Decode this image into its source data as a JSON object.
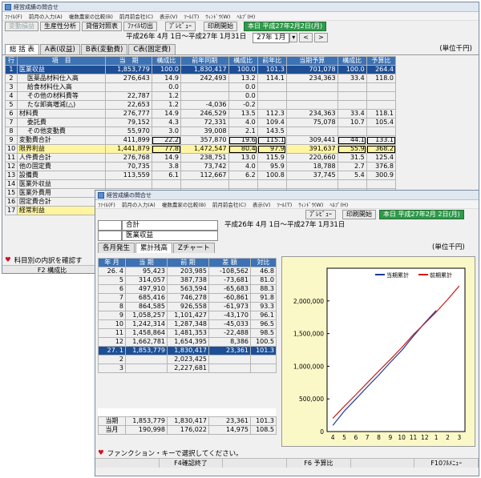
{
  "win1": {
    "title": "経営成績の問合せ",
    "menu": [
      "ﾌｧｲﾙ(F)",
      "前月の入力(A)",
      "複数農家の比較(B)",
      "前月前会社(C)",
      "表示(V)",
      "ﾂｰﾙ(T)",
      "ｳｨﾝﾄﾞｳ(W)",
      "ﾍﾙﾌﾟ(H)"
    ],
    "toolbar": [
      "変動損益",
      "生産性分析",
      "貸借対照表",
      "ﾌｧｲﾙ切出",
      "ﾌﾟﾚﾋﾞｭｰ",
      "印刷開始"
    ],
    "date_badge": "本日 平成27年2月2日(月)",
    "range": "平成26年 4月 1日～平成27年 1月31日",
    "period": "27年 1月",
    "tabs": [
      "総 括 表",
      "A表(収益)",
      "B表(変動費)",
      "C表(固定費)"
    ],
    "unit": "(単位千円)",
    "headers": [
      "行",
      "項　目",
      "当　期",
      "構成比",
      "前年同期",
      "構成比",
      "前年比",
      "当期予算",
      "構成比",
      "予算比"
    ],
    "rows": [
      [
        "1",
        "医業収益",
        "1,853,779",
        "100.0",
        "1,830,417",
        "100.0",
        "101.3",
        "701,078",
        "100.0",
        "264.4"
      ],
      [
        "2",
        "医薬品材料仕入高",
        "276,643",
        "14.9",
        "242,493",
        "13.2",
        "114.1",
        "234,363",
        "33.4",
        "118.0"
      ],
      [
        "3",
        "給食材料仕入高",
        "",
        "0.0",
        "",
        "0.0",
        "",
        "",
        "",
        ""
      ],
      [
        "4",
        "その他の材料費等",
        "22,787",
        "1.2",
        "",
        "0.0",
        "",
        "",
        "",
        ""
      ],
      [
        "5",
        "たな卸高増減(△)",
        "22,653",
        "1.2",
        "-4,036",
        "-0.2",
        "",
        "",
        "",
        ""
      ],
      [
        "6",
        "材料費",
        "276,777",
        "14.9",
        "246,529",
        "13.5",
        "112.3",
        "234,363",
        "33.4",
        "118.1"
      ],
      [
        "7",
        "委託費",
        "79,152",
        "4.3",
        "72,331",
        "4.0",
        "109.4",
        "75,078",
        "10.7",
        "105.4"
      ],
      [
        "8",
        "その他変動費",
        "55,970",
        "3.0",
        "39,008",
        "2.1",
        "143.5",
        "",
        "",
        ""
      ],
      [
        "9",
        "変動費合計",
        "411,899",
        "22.2",
        "357,870",
        "19.6",
        "115.1",
        "309,441",
        "44.1",
        "133.1"
      ],
      [
        "10",
        "限界利益",
        "1,441,879",
        "77.8",
        "1,472,547",
        "80.4",
        "97.9",
        "391,637",
        "55.9",
        "368.2"
      ],
      [
        "11",
        "人件費合計",
        "276,768",
        "14.9",
        "238,751",
        "13.0",
        "115.9",
        "220,660",
        "31.5",
        "125.4"
      ],
      [
        "12",
        "他の固定費",
        "70,735",
        "3.8",
        "73,742",
        "4.0",
        "95.9",
        "18,788",
        "2.7",
        "376.8"
      ],
      [
        "13",
        "設備費",
        "113,559",
        "6.1",
        "112,667",
        "6.2",
        "100.8",
        "37,745",
        "5.4",
        "300.9"
      ],
      [
        "14",
        "医業外収益",
        "",
        "",
        "",
        "",
        "",
        "",
        "",
        ""
      ],
      [
        "15",
        "医業外費用",
        "",
        "",
        "",
        "",
        "",
        "",
        "",
        ""
      ],
      [
        "16",
        "固定費合計",
        "",
        "",
        "",
        "",
        "",
        "",
        "",
        ""
      ],
      [
        "17",
        "経常利益",
        "",
        "",
        "",
        "",
        "",
        "",
        "",
        ""
      ]
    ],
    "status": "科目別の内訳を確認す",
    "fkey": "F2 構成比"
  },
  "win2": {
    "title": "経営成績の問合せ",
    "menu": [
      "ﾌｧｲﾙ(F)",
      "前月の入力(A)",
      "複数農家の比較(B)",
      "前月前会社(C)",
      "表示(V)",
      "ﾂｰﾙ(T)",
      "ｳｨﾝﾄﾞｳ(W)",
      "ﾍﾙﾌﾟ(H)"
    ],
    "preview": "ﾌﾟﾚﾋﾞｭｰ",
    "print": "印刷開始",
    "date_badge": "本日 平成27年2月 2日(月)",
    "item1": "合計",
    "item2": "医業収益",
    "range": "平成26年 4月 1日～平成27年 1月31日",
    "tabs": [
      "各月発生",
      "累計残高",
      "Zチャート"
    ],
    "unit": "(単位千円)",
    "headers": [
      "年 月",
      "当 期",
      "前 期",
      "差 額",
      "対比"
    ],
    "rows": [
      [
        "26. 4",
        "95,423",
        "203,985",
        "-108,562",
        "46.8"
      ],
      [
        "5",
        "314,057",
        "387,738",
        "-73,681",
        "81.0"
      ],
      [
        "6",
        "497,910",
        "563,594",
        "-65,683",
        "88.3"
      ],
      [
        "7",
        "685,416",
        "746,278",
        "-60,861",
        "91.8"
      ],
      [
        "8",
        "864,585",
        "926,558",
        "-61,973",
        "93.3"
      ],
      [
        "9",
        "1,058,257",
        "1,101,427",
        "-43,170",
        "96.1"
      ],
      [
        "10",
        "1,242,314",
        "1,287,348",
        "-45,033",
        "96.5"
      ],
      [
        "11",
        "1,458,864",
        "1,481,353",
        "-22,488",
        "98.5"
      ],
      [
        "12",
        "1,662,781",
        "1,654,395",
        "8,386",
        "100.5"
      ],
      [
        "27. 1",
        "1,853,779",
        "1,830,417",
        "23,361",
        "101.3"
      ],
      [
        "2",
        "",
        "2,023,425",
        "",
        ""
      ],
      [
        "3",
        "",
        "2,227,681",
        "",
        ""
      ]
    ],
    "footer": [
      [
        "当期",
        "1,853,779",
        "1,830,417",
        "23,361",
        "101.3"
      ],
      [
        "当月",
        "190,998",
        "176,022",
        "14,975",
        "108.5"
      ]
    ],
    "status": "ファンクション・キーで選択してください。",
    "fkeys": [
      "",
      "F4確認終了",
      "",
      "F6 予算比",
      "",
      "F10ﾌﾙﾒﾆｭｰ"
    ]
  },
  "chart_data": {
    "type": "line",
    "x": [
      4,
      5,
      6,
      7,
      8,
      9,
      10,
      11,
      12,
      1,
      2,
      3
    ],
    "xlabel": "",
    "ylabel": "",
    "ylim": [
      0,
      2500000
    ],
    "yticks": [
      "0",
      "500,000",
      "1,000,000",
      "1,500,000",
      "2,000,000"
    ],
    "grid": false,
    "legend": "top-right",
    "series": [
      {
        "name": "当期累計",
        "color": "#1a3a9a",
        "values": [
          95423,
          314057,
          497910,
          685416,
          864585,
          1058257,
          1242314,
          1458864,
          1662781,
          1853779
        ]
      },
      {
        "name": "前期累計",
        "color": "#d01818",
        "values": [
          203985,
          387738,
          563594,
          746278,
          926558,
          1101427,
          1287348,
          1481353,
          1654395,
          1830417,
          2023425,
          2227681
        ]
      }
    ]
  }
}
